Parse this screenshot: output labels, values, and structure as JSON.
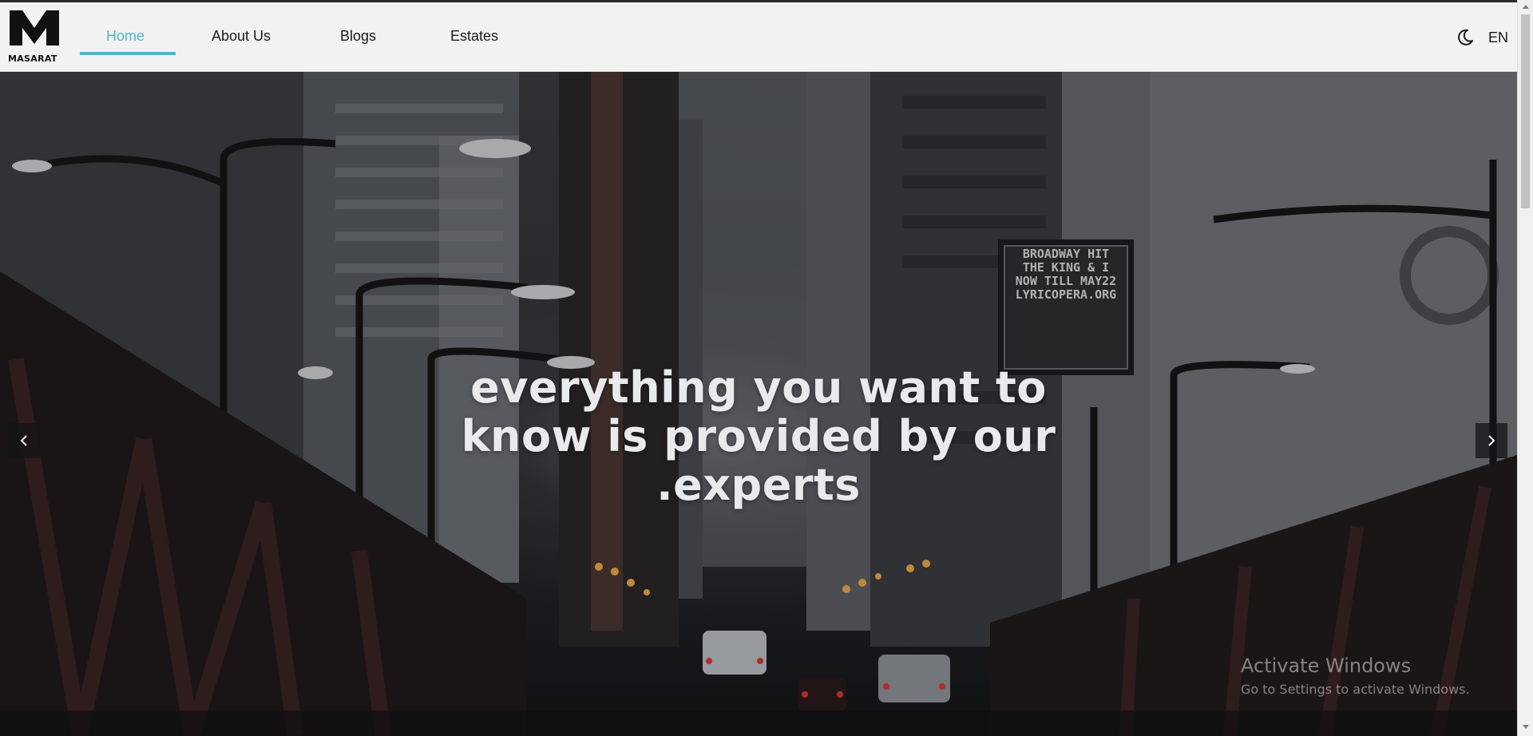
{
  "brand": {
    "name": "MASARAT",
    "logo_icon": "m-logo-icon"
  },
  "nav": {
    "items": [
      {
        "label": "Home",
        "active": true
      },
      {
        "label": "About Us",
        "active": false
      },
      {
        "label": "Blogs",
        "active": false
      },
      {
        "label": "Estates",
        "active": false
      }
    ],
    "accent_color": "#4fb8c4",
    "theme_toggle_icon": "moon-icon",
    "language": "EN"
  },
  "hero": {
    "headline": "everything you want to know is provided by our .experts",
    "prev_icon": "chevron-left-icon",
    "next_icon": "chevron-right-icon",
    "sign_lines": [
      "BROADWAY HIT",
      "THE KING & I",
      "NOW TILL MAY22",
      "LYRICOPERA.ORG"
    ]
  },
  "watermark": {
    "title": "Activate Windows",
    "subtitle": "Go to Settings to activate Windows."
  }
}
